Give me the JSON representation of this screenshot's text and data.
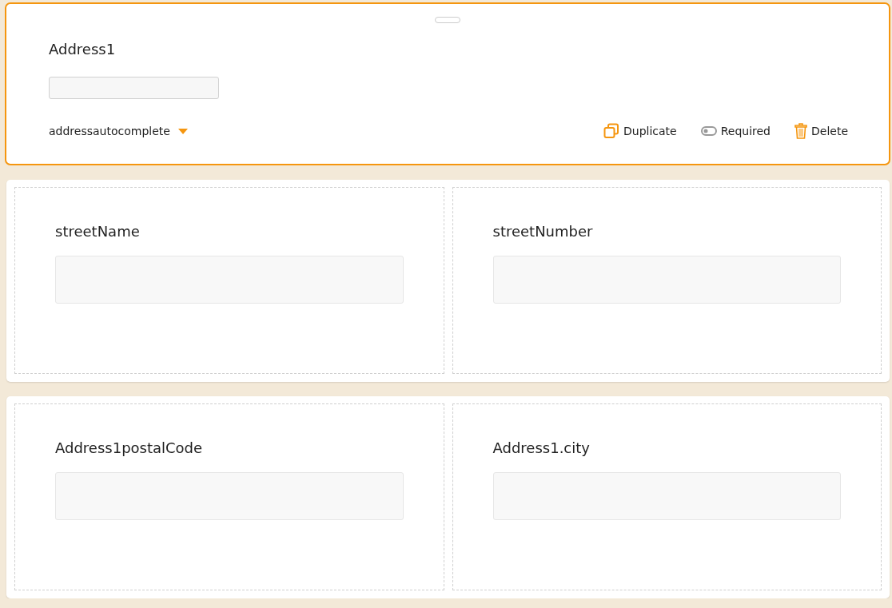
{
  "field": {
    "label": "Address1",
    "type_selector": "addressautocomplete",
    "actions": [
      {
        "kind": "duplicate",
        "label": "Duplicate"
      },
      {
        "kind": "required",
        "label": "Required",
        "on": false
      },
      {
        "kind": "delete",
        "label": "Delete"
      }
    ]
  },
  "rows": [
    {
      "cells": [
        {
          "label": "streetName"
        },
        {
          "label": "streetNumber"
        }
      ]
    },
    {
      "cells": [
        {
          "label": "Address1postalCode"
        },
        {
          "label": "Address1.city"
        }
      ]
    }
  ]
}
